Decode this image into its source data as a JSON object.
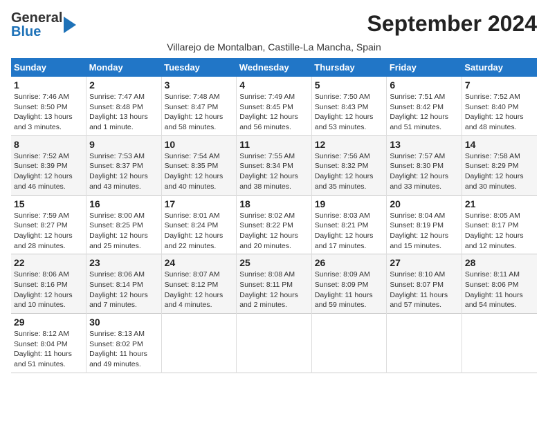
{
  "logo": {
    "line1": "General",
    "line2": "Blue"
  },
  "title": "September 2024",
  "subtitle": "Villarejo de Montalban, Castille-La Mancha, Spain",
  "days_header": [
    "Sunday",
    "Monday",
    "Tuesday",
    "Wednesday",
    "Thursday",
    "Friday",
    "Saturday"
  ],
  "weeks": [
    [
      {
        "num": "1",
        "info": "Sunrise: 7:46 AM\nSunset: 8:50 PM\nDaylight: 13 hours\nand 3 minutes."
      },
      {
        "num": "2",
        "info": "Sunrise: 7:47 AM\nSunset: 8:48 PM\nDaylight: 13 hours\nand 1 minute."
      },
      {
        "num": "3",
        "info": "Sunrise: 7:48 AM\nSunset: 8:47 PM\nDaylight: 12 hours\nand 58 minutes."
      },
      {
        "num": "4",
        "info": "Sunrise: 7:49 AM\nSunset: 8:45 PM\nDaylight: 12 hours\nand 56 minutes."
      },
      {
        "num": "5",
        "info": "Sunrise: 7:50 AM\nSunset: 8:43 PM\nDaylight: 12 hours\nand 53 minutes."
      },
      {
        "num": "6",
        "info": "Sunrise: 7:51 AM\nSunset: 8:42 PM\nDaylight: 12 hours\nand 51 minutes."
      },
      {
        "num": "7",
        "info": "Sunrise: 7:52 AM\nSunset: 8:40 PM\nDaylight: 12 hours\nand 48 minutes."
      }
    ],
    [
      {
        "num": "8",
        "info": "Sunrise: 7:52 AM\nSunset: 8:39 PM\nDaylight: 12 hours\nand 46 minutes."
      },
      {
        "num": "9",
        "info": "Sunrise: 7:53 AM\nSunset: 8:37 PM\nDaylight: 12 hours\nand 43 minutes."
      },
      {
        "num": "10",
        "info": "Sunrise: 7:54 AM\nSunset: 8:35 PM\nDaylight: 12 hours\nand 40 minutes."
      },
      {
        "num": "11",
        "info": "Sunrise: 7:55 AM\nSunset: 8:34 PM\nDaylight: 12 hours\nand 38 minutes."
      },
      {
        "num": "12",
        "info": "Sunrise: 7:56 AM\nSunset: 8:32 PM\nDaylight: 12 hours\nand 35 minutes."
      },
      {
        "num": "13",
        "info": "Sunrise: 7:57 AM\nSunset: 8:30 PM\nDaylight: 12 hours\nand 33 minutes."
      },
      {
        "num": "14",
        "info": "Sunrise: 7:58 AM\nSunset: 8:29 PM\nDaylight: 12 hours\nand 30 minutes."
      }
    ],
    [
      {
        "num": "15",
        "info": "Sunrise: 7:59 AM\nSunset: 8:27 PM\nDaylight: 12 hours\nand 28 minutes."
      },
      {
        "num": "16",
        "info": "Sunrise: 8:00 AM\nSunset: 8:25 PM\nDaylight: 12 hours\nand 25 minutes."
      },
      {
        "num": "17",
        "info": "Sunrise: 8:01 AM\nSunset: 8:24 PM\nDaylight: 12 hours\nand 22 minutes."
      },
      {
        "num": "18",
        "info": "Sunrise: 8:02 AM\nSunset: 8:22 PM\nDaylight: 12 hours\nand 20 minutes."
      },
      {
        "num": "19",
        "info": "Sunrise: 8:03 AM\nSunset: 8:21 PM\nDaylight: 12 hours\nand 17 minutes."
      },
      {
        "num": "20",
        "info": "Sunrise: 8:04 AM\nSunset: 8:19 PM\nDaylight: 12 hours\nand 15 minutes."
      },
      {
        "num": "21",
        "info": "Sunrise: 8:05 AM\nSunset: 8:17 PM\nDaylight: 12 hours\nand 12 minutes."
      }
    ],
    [
      {
        "num": "22",
        "info": "Sunrise: 8:06 AM\nSunset: 8:16 PM\nDaylight: 12 hours\nand 10 minutes."
      },
      {
        "num": "23",
        "info": "Sunrise: 8:06 AM\nSunset: 8:14 PM\nDaylight: 12 hours\nand 7 minutes."
      },
      {
        "num": "24",
        "info": "Sunrise: 8:07 AM\nSunset: 8:12 PM\nDaylight: 12 hours\nand 4 minutes."
      },
      {
        "num": "25",
        "info": "Sunrise: 8:08 AM\nSunset: 8:11 PM\nDaylight: 12 hours\nand 2 minutes."
      },
      {
        "num": "26",
        "info": "Sunrise: 8:09 AM\nSunset: 8:09 PM\nDaylight: 11 hours\nand 59 minutes."
      },
      {
        "num": "27",
        "info": "Sunrise: 8:10 AM\nSunset: 8:07 PM\nDaylight: 11 hours\nand 57 minutes."
      },
      {
        "num": "28",
        "info": "Sunrise: 8:11 AM\nSunset: 8:06 PM\nDaylight: 11 hours\nand 54 minutes."
      }
    ],
    [
      {
        "num": "29",
        "info": "Sunrise: 8:12 AM\nSunset: 8:04 PM\nDaylight: 11 hours\nand 51 minutes."
      },
      {
        "num": "30",
        "info": "Sunrise: 8:13 AM\nSunset: 8:02 PM\nDaylight: 11 hours\nand 49 minutes."
      },
      {
        "num": "",
        "info": ""
      },
      {
        "num": "",
        "info": ""
      },
      {
        "num": "",
        "info": ""
      },
      {
        "num": "",
        "info": ""
      },
      {
        "num": "",
        "info": ""
      }
    ]
  ]
}
